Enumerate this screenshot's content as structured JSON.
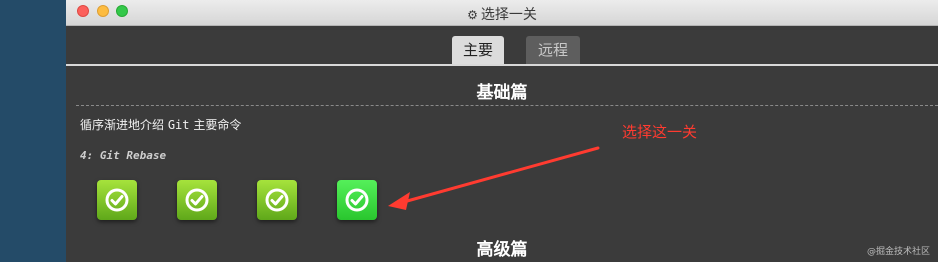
{
  "window": {
    "title": "选择一关",
    "title_icon": "gear-icon"
  },
  "tabs": [
    {
      "label": "主要",
      "active": true
    },
    {
      "label": "远程",
      "active": false
    }
  ],
  "sections": {
    "basic": {
      "title": "基础篇",
      "description_prefix": "循序渐进地介绍 ",
      "description_code": "Git",
      "description_suffix": " 主要命令",
      "current_level": "4: Git Rebase",
      "levels": [
        {
          "icon": "check-icon",
          "completed": true
        },
        {
          "icon": "check-icon",
          "completed": true
        },
        {
          "icon": "check-icon",
          "completed": true
        },
        {
          "icon": "check-icon",
          "completed": true,
          "current": true
        }
      ]
    },
    "advanced": {
      "title": "高级篇"
    }
  },
  "annotation": {
    "text": "选择这一关",
    "color": "#ff3b30"
  },
  "watermark": "@掘金技术社区",
  "colors": {
    "level_green": "#7cc52a",
    "level_current": "#3ddc43",
    "panel": "#3b3b3b"
  }
}
